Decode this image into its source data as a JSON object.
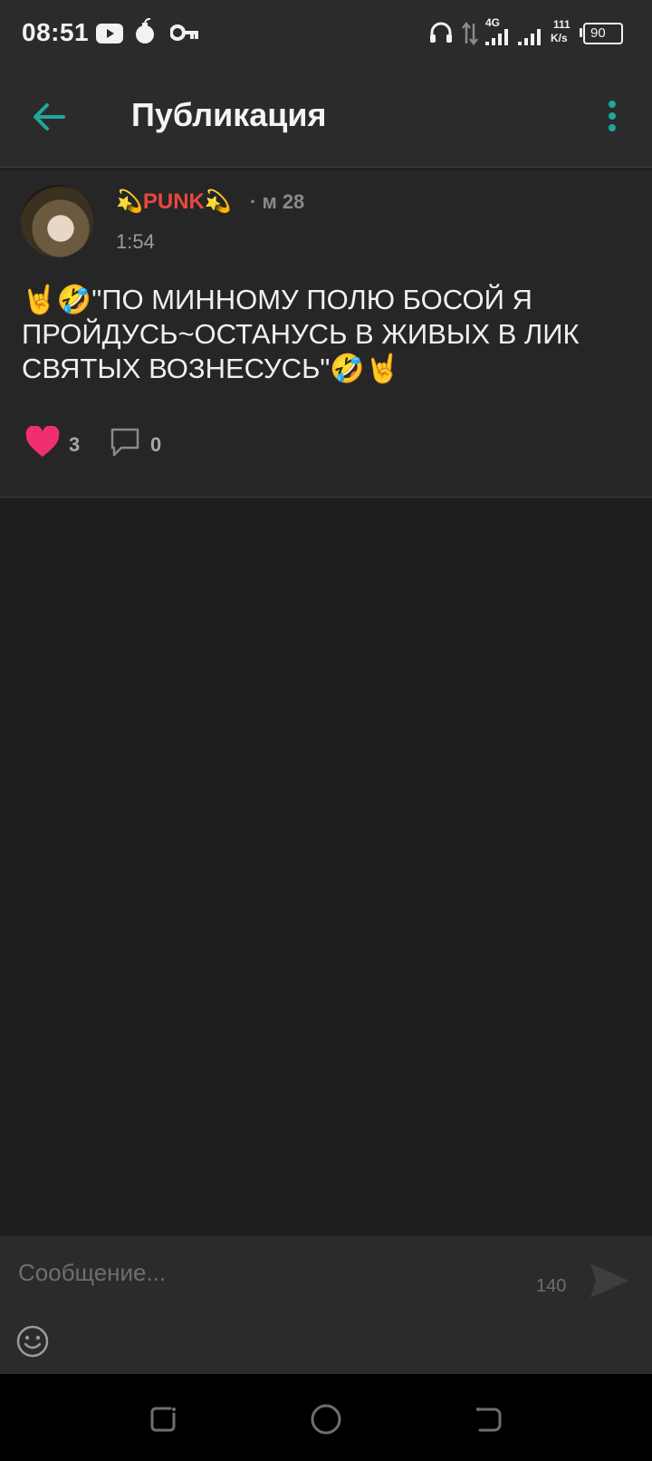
{
  "status_bar": {
    "time": "08:51",
    "network_type": "4G",
    "speed_value": "111",
    "speed_unit": "K/s",
    "battery": "90",
    "icons": [
      "youtube-icon",
      "bomb-icon",
      "vpn-key-icon",
      "headphones-icon",
      "data-arrows-icon",
      "signal-icon",
      "signal-icon",
      "battery-icon"
    ]
  },
  "app_bar": {
    "title": "Публикация",
    "back_icon": "arrow-left-icon",
    "more_icon": "more-vertical-icon"
  },
  "post": {
    "author": "💫PUNK💫",
    "meta": "· м 28",
    "time": "1:54",
    "text": "🤘🤣\"ПО МИННОМУ ПОЛЮ БОСОЙ Я ПРОЙДУСЬ~ОСТАНУСЬ В ЖИВЫХ В ЛИК СВЯТЫХ ВОЗНЕСУСЬ\"🤣🤘",
    "likes": "3",
    "comments": "0"
  },
  "composer": {
    "placeholder": "Сообщение...",
    "counter": "140",
    "send_icon": "send-icon",
    "emoji_icon": "smiley-icon"
  },
  "nav_bar": {
    "icons": [
      "recent-apps-icon",
      "home-icon",
      "back-icon"
    ]
  },
  "colors": {
    "accent": "#1fa89c",
    "background": "#1f1f20",
    "card": "#262627",
    "author": "#e8473f",
    "like": "#f0306e"
  }
}
